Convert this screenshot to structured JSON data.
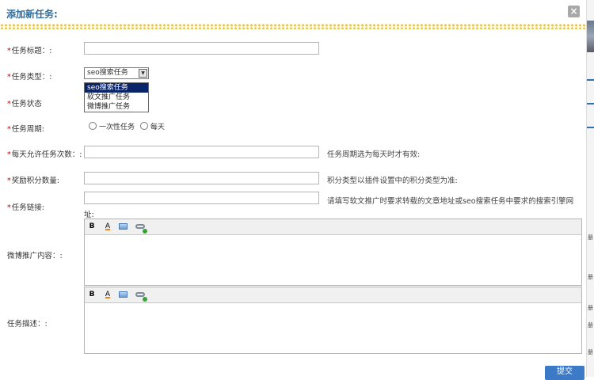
{
  "dialog": {
    "title": "添加新任务:",
    "close_icon": "close-icon",
    "submit_label": "提交"
  },
  "form": {
    "title_label": "任务标题：:",
    "type_label": "任务类型：:",
    "type_selected": "seo搜索任务",
    "type_options": [
      "seo搜索任务",
      "软文推广任务",
      "微博推广任务"
    ],
    "status_label": "任务状态",
    "period_label": "任务周期:",
    "period_options": [
      "一次性任务",
      "每天"
    ],
    "daily_count_label": "每天允许任务次数：:",
    "daily_count_hint": "任务周期选为每天时才有效:",
    "points_label": "奖励积分数量:",
    "points_hint": "积分类型以插件设置中的积分类型为准:",
    "link_label": "任务链接:",
    "link_hint": "请填写软文推广时要求转载的文章地址或seo搜索任务中要求的搜索引擎网",
    "link_hint_cont": "址:",
    "weibo_label": "微博推广内容：:",
    "desc_label": "任务描述：:",
    "required_mark": "*"
  },
  "editor_toolbar": {
    "bold": "B",
    "font_color": "A",
    "image_icon": "image-icon",
    "link_icon": "link-icon"
  },
  "background": {
    "side_glyphs": [
      "册",
      "册",
      "册",
      "册",
      "册"
    ]
  }
}
